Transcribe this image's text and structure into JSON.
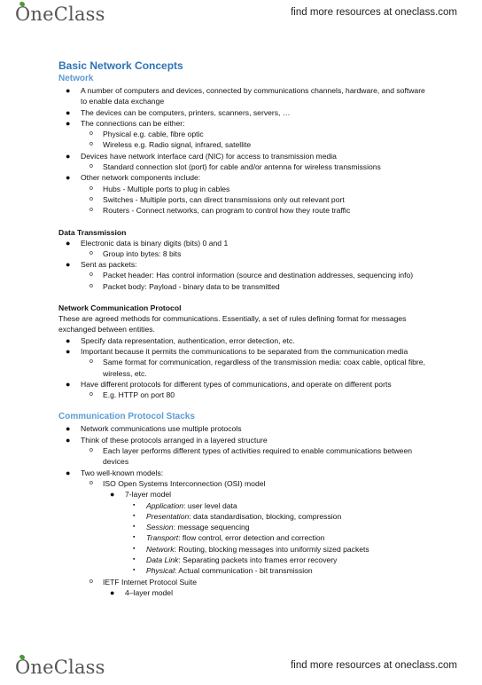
{
  "header": {
    "logo": "OneClass",
    "tagline": "find more resources at oneclass.com"
  },
  "footer": {
    "logo": "OneClass",
    "tagline": "find more resources at oneclass.com"
  },
  "document": {
    "title": "Basic Network Concepts",
    "network": {
      "heading": "Network",
      "items": [
        "A number of computers and devices, connected by communications channels, hardware, and software to enable data exchange",
        "The devices can be computers, printers, scanners, servers, …",
        "The connections can be either:",
        "Physical e.g. cable, fibre optic",
        "Wireless e.g. Radio signal, infrared, satellite",
        "Devices have network interface card (NIC) for access to transmission media",
        "Standard connection slot (port) for cable and/or antenna for wireless transmissions",
        "Other network components include:",
        "Hubs - Multiple ports to plug in cables",
        "Switches - Multiple ports, can direct transmissions only out relevant port",
        "Routers - Connect networks, can program to control how they route traffic"
      ]
    },
    "data_transmission": {
      "heading": "Data Transmission",
      "items": [
        "Electronic data is binary digits (bits) 0 and 1",
        "Group into bytes: 8 bits",
        "Sent as packets:",
        "Packet header: Has control information (source and destination addresses, sequencing info)",
        "Packet body: Payload - binary data to be transmitted"
      ]
    },
    "protocol": {
      "heading": "Network Communication Protocol",
      "intro": "These are agreed methods for communications. Essentially, a set of rules defining format for messages exchanged between entities.",
      "items": [
        "Specify data representation, authentication, error detection, etc.",
        "Important because it permits the communications to be separated from the communication media",
        "Same format for communication, regardless of the transmission media: coax cable, optical fibre, wireless, etc.",
        "Have different protocols for different types of communications, and operate on different ports",
        "E.g. HTTP on port 80"
      ]
    },
    "stacks": {
      "heading": "Communication Protocol Stacks",
      "items": [
        "Network communications use multiple protocols",
        "Think of these protocols arranged in a layered structure",
        "Each layer performs different types of activities required to enable communications between devices",
        "Two well-known models:",
        "ISO Open Systems Interconnection (OSI) model",
        "7-layer model",
        "IETF Internet Protocol Suite",
        "4–layer model"
      ],
      "osi_layers": [
        {
          "name": "Application",
          "desc": ": user level data"
        },
        {
          "name": "Presentation",
          "desc": ": data standardisation, blocking, compression"
        },
        {
          "name": "Session",
          "desc": ": message sequencing"
        },
        {
          "name": "Transport",
          "desc": ": flow control, error detection and correction"
        },
        {
          "name": "Network",
          "desc": ": Routing, blocking messages into uniformly sized packets"
        },
        {
          "name": "Data Link",
          "desc": ": Separating packets into frames error recovery"
        },
        {
          "name": "Physical",
          "desc": ": Actual communication - bit transmission"
        }
      ]
    }
  },
  "bullets": {
    "disc": "●",
    "circle": "o",
    "square": "▪"
  }
}
